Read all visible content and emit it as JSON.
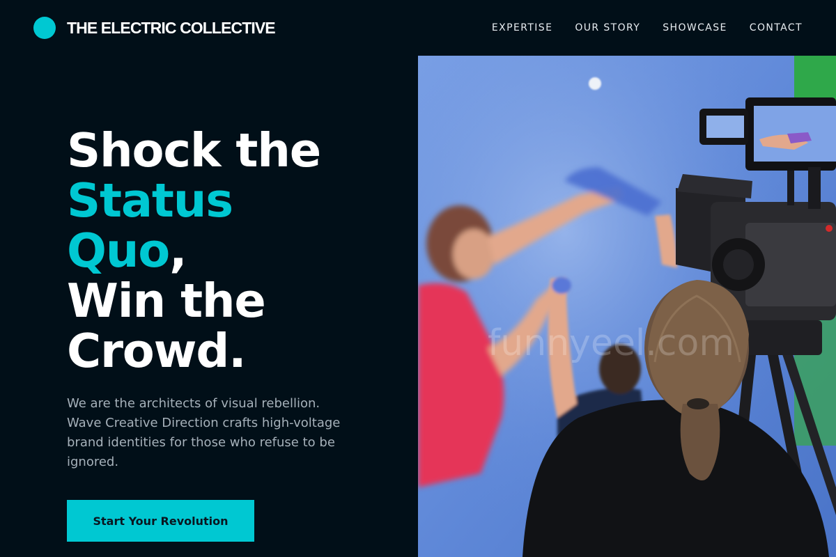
{
  "brand": {
    "name": "THE ELECTRIC COLLECTIVE",
    "logo_icon": "cyan-dot-logo",
    "accent_color": "#00c8d2"
  },
  "nav": {
    "items": [
      {
        "label": "EXPERTISE"
      },
      {
        "label": "OUR STORY"
      },
      {
        "label": "SHOWCASE"
      },
      {
        "label": "CONTACT"
      }
    ]
  },
  "hero": {
    "headline": {
      "line1": "Shock the",
      "line2_accent": "Status",
      "line3_accent": "Quo",
      "line3_rest": ",",
      "line4": "Win the",
      "line5": "Crowd."
    },
    "description": "We are the architects of visual rebellion. Wave Creative Direction crafts high-voltage brand identities for those who refuse to be ignored.",
    "cta_label": "Start Your Revolution",
    "image_watermark": "funnyeel.com"
  },
  "colors": {
    "background": "#010f18",
    "accent": "#00c8d2",
    "text": "#ffffff",
    "muted_text": "#a6b1ba",
    "cta_text": "#0a1620"
  }
}
